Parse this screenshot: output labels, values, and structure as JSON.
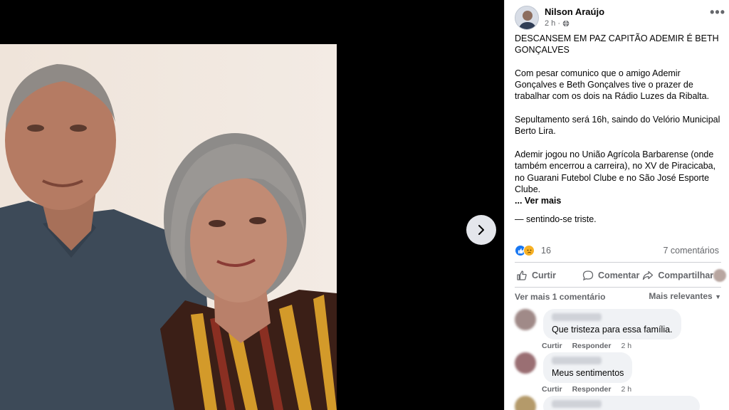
{
  "post": {
    "author": "Nilson Araújo",
    "time": "2 h ·",
    "privacy_icon": "globe-icon",
    "more_label": "•••",
    "title": "DESCANSEM EM PAZ CAPITÃO ADEMIR É BETH GONÇALVES",
    "paragraph1": "Com pesar comunico que o amigo Ademir Gonçalves e Beth Gonçalves tive o prazer de trabalhar com os dois na Rádio Luzes da Ribalta.",
    "paragraph2": "Sepultamento será 16h, saindo do Velório Municipal Berto Lira.",
    "paragraph3": "Ademir jogou no União Agrícola Barbarense (onde também encerrou a carreira), no XV de Piracicaba, no Guarani Futebol Clube e no São José Esporte Clube.",
    "see_more": "... Ver mais",
    "feeling": "— sentindo-se triste."
  },
  "reactions": {
    "count": "16",
    "comments": "7 comentários"
  },
  "actions": {
    "like": "Curtir",
    "comment": "Comentar",
    "share": "Compartilhar"
  },
  "comments_section": {
    "see_more": "Ver mais 1 comentário",
    "sort": "Mais relevantes"
  },
  "comments": [
    {
      "text": "Que tristeza para essa família.",
      "like": "Curtir",
      "reply": "Responder",
      "time": "2 h"
    },
    {
      "text": "Meus sentimentos",
      "like": "Curtir",
      "reply": "Responder",
      "time": "2 h"
    }
  ],
  "colors": {
    "like_blue": "#1877f2",
    "text_gray": "#65676b",
    "bubble": "#f0f2f5"
  }
}
